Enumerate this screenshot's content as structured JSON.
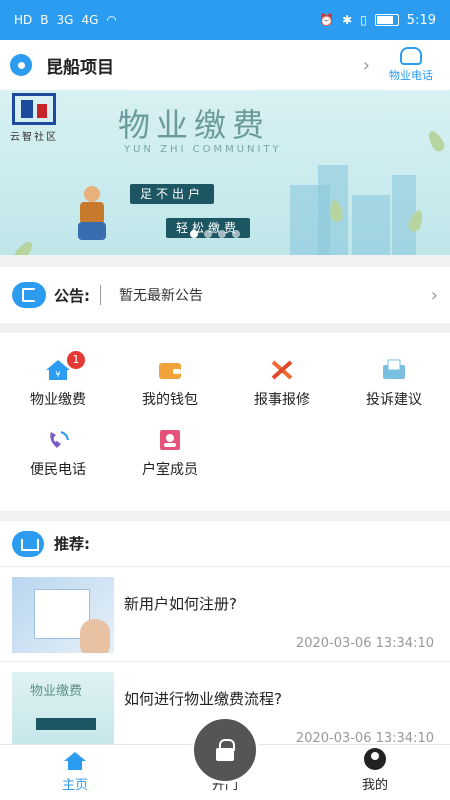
{
  "status_bar": {
    "net_labels": [
      "HD",
      "B",
      "3G",
      "4G"
    ],
    "time": "5:19"
  },
  "header": {
    "project_name": "昆船项目",
    "phone_label": "物业电话"
  },
  "banner": {
    "logo_text": "云智社区",
    "title": "物业缴费",
    "subtitle": "YUN ZHI COMMUNITY",
    "tag1": "足不出户",
    "tag2": "轻松缴费"
  },
  "notice": {
    "label": "公告:",
    "text": "暂无最新公告"
  },
  "quick_actions": [
    {
      "label": "物业缴费",
      "icon": "house-yen-icon",
      "badge": "1",
      "color": "#2c9cf0"
    },
    {
      "label": "我的钱包",
      "icon": "wallet-icon",
      "badge": null,
      "color": "#f2a23a"
    },
    {
      "label": "报事报修",
      "icon": "tools-icon",
      "badge": null,
      "color": "#f06a35"
    },
    {
      "label": "投诉建议",
      "icon": "complaint-icon",
      "badge": null,
      "color": "#7ac0e0"
    },
    {
      "label": "便民电话",
      "icon": "phone-icon",
      "badge": null,
      "color": "#7a5cc8"
    },
    {
      "label": "户室成员",
      "icon": "member-icon",
      "badge": null,
      "color": "#e8527a"
    }
  ],
  "recommend": {
    "title": "推荐:",
    "articles": [
      {
        "title": "新用户如何注册?",
        "time": "2020-03-06 13:34:10"
      },
      {
        "title": "如何进行物业缴费流程?",
        "time": "2020-03-06 13:34:10",
        "thumb_title": "物业缴费"
      }
    ]
  },
  "tabbar": {
    "home": "主页",
    "door": "开门",
    "mine": "我的"
  },
  "colors": {
    "primary": "#2c9cf0",
    "badge": "#e53935"
  }
}
